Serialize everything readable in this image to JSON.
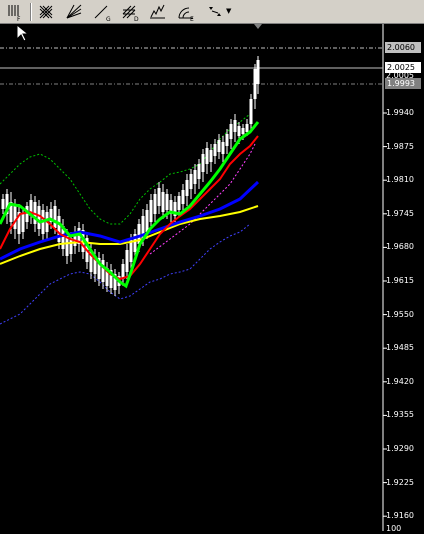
{
  "toolbar": {
    "buttons": [
      {
        "name": "vertical-line-tool",
        "icon": "vertical-lines-icon",
        "sub": "F"
      },
      {
        "name": "grid-tool",
        "icon": "grid-icon",
        "sub": ""
      },
      {
        "name": "fibonacci-fan-tool",
        "icon": "fan-icon",
        "sub": ""
      },
      {
        "name": "gann-line-tool",
        "icon": "gann-line-icon",
        "sub": "G"
      },
      {
        "name": "gann-grid-tool",
        "icon": "gann-grid-icon",
        "sub": "D"
      },
      {
        "name": "elliott-wave-tool",
        "icon": "wave-icon",
        "sub": ""
      },
      {
        "name": "fibonacci-arcs-tool",
        "icon": "arc-icon",
        "sub": "E"
      },
      {
        "name": "arrows-tool",
        "icon": "arrows-icon",
        "sub": ""
      }
    ],
    "dropdown_arrow": "▼"
  },
  "price_axis": {
    "labels": [
      "1.9940",
      "1.9875",
      "1.9810",
      "1.9745",
      "1.9680",
      "1.9615",
      "1.9550",
      "1.9485",
      "1.9420",
      "1.9355",
      "1.9290",
      "1.9225",
      "1.9160"
    ],
    "bottom_label": "100",
    "boxes": [
      {
        "text": "2.0060",
        "bg": "#c0c0c0",
        "fg": "#000000"
      },
      {
        "text": "2.0025",
        "bg": "#ffffff",
        "fg": "#000000"
      },
      {
        "text": "1.9993",
        "bg": "#808080",
        "fg": "#ffffff"
      }
    ],
    "partial_label": "2.0005"
  },
  "colors": {
    "background": "#000000",
    "bull_candle": "#ffffff",
    "bear_candle": "#ffffff",
    "ma_fast": "#00ff00",
    "ma_mid": "#ff0000",
    "ma_slow": "#0000ff",
    "ma_long": "#ffff00",
    "bollinger_upper": "#00c000",
    "bollinger_lower": "#4040ff",
    "envelope_pink": "#ff40ff"
  }
}
